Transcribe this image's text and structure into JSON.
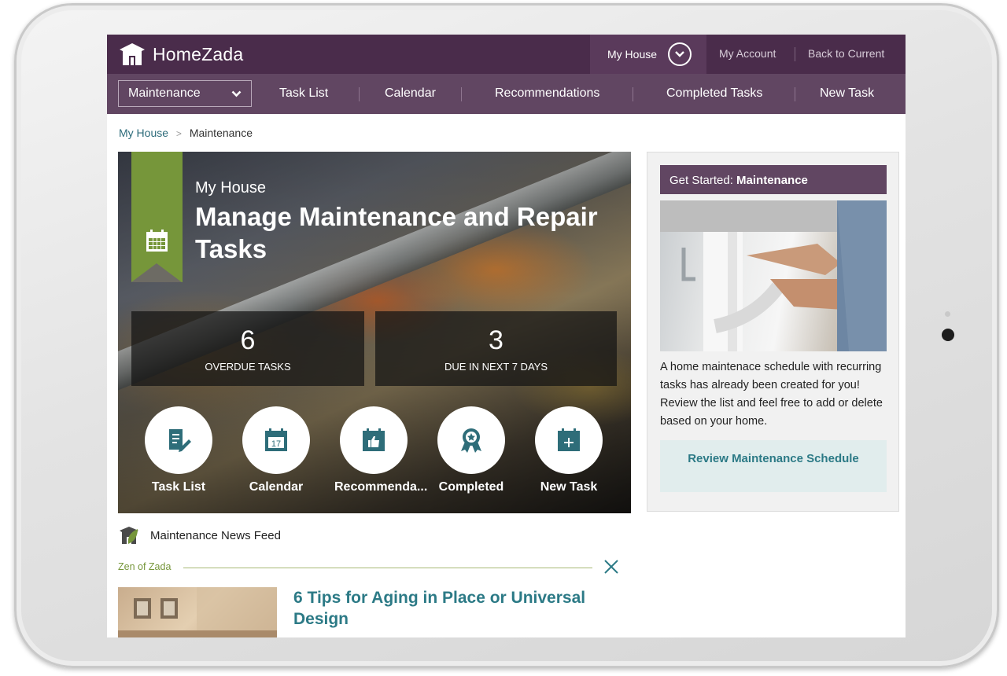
{
  "brand": {
    "name": "HomeZada"
  },
  "topbar": {
    "house_selector": "My House",
    "my_account": "My Account",
    "back_to_current": "Back to Current"
  },
  "nav": {
    "section_select": "Maintenance",
    "items": [
      "Task List",
      "Calendar",
      "Recommendations",
      "Completed Tasks",
      "New Task"
    ]
  },
  "breadcrumb": {
    "home": "My House",
    "current": "Maintenance"
  },
  "hero": {
    "subtitle": "My House",
    "title": "Manage Maintenance and Repair Tasks",
    "ribbon_icon": "calendar-icon",
    "stats": [
      {
        "value": "6",
        "label": "OVERDUE TASKS"
      },
      {
        "value": "3",
        "label": "DUE IN NEXT 7 DAYS"
      }
    ],
    "quick_actions": [
      {
        "label": "Task List",
        "icon": "task-list-icon"
      },
      {
        "label": "Calendar",
        "icon": "calendar-17-icon",
        "icon_text": "17"
      },
      {
        "label": "Recommenda...",
        "icon": "thumbs-up-calendar-icon"
      },
      {
        "label": "Completed",
        "icon": "award-ribbon-icon"
      },
      {
        "label": "New Task",
        "icon": "calendar-plus-icon"
      }
    ]
  },
  "get_started": {
    "heading_prefix": "Get Started: ",
    "heading_bold": "Maintenance",
    "description": "A home maintenace schedule with recurring tasks has already been created for you! Review the list and feel free to add or delete based on your home.",
    "button": "Review Maintenance Schedule"
  },
  "news_feed": {
    "title": "Maintenance News Feed",
    "category": "Zen of Zada",
    "article_title": "6 Tips for Aging in Place or Universal Design"
  },
  "colors": {
    "topbar": "#4a2c4b",
    "navbar": "#614662",
    "accent_green": "#76963a",
    "link_teal": "#2c7a86"
  }
}
